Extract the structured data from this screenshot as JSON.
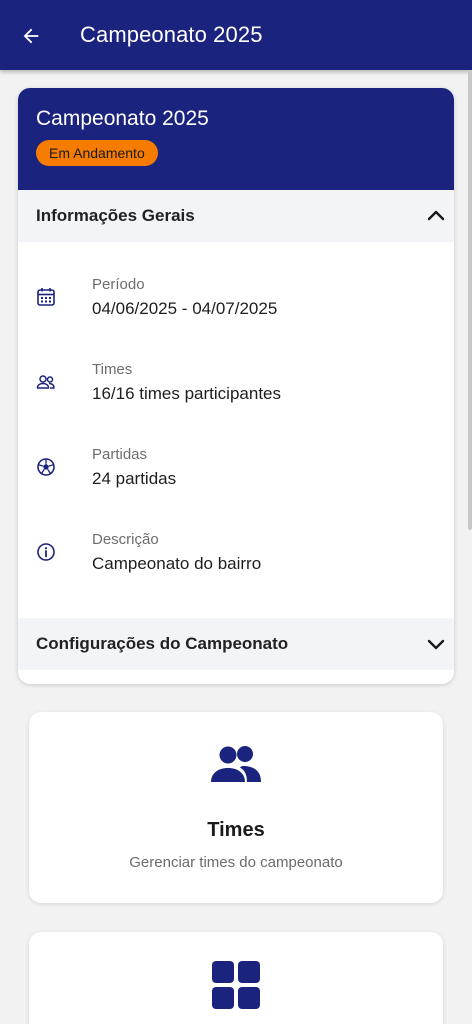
{
  "appbar": {
    "title": "Campeonato 2025",
    "back_icon": "arrow-left-icon"
  },
  "championship": {
    "title": "Campeonato 2025",
    "status": "Em Andamento",
    "colors": {
      "header": "#1a237e",
      "status_badge": "#f57c00"
    }
  },
  "general_info": {
    "title": "Informações Gerais",
    "expanded": true,
    "items": [
      {
        "icon": "calendar-icon",
        "label": "Período",
        "value": "04/06/2025 - 04/07/2025"
      },
      {
        "icon": "users-icon",
        "label": "Times",
        "value": "16/16 times participantes"
      },
      {
        "icon": "soccer-ball-icon",
        "label": "Partidas",
        "value": "24 partidas"
      },
      {
        "icon": "info-icon",
        "label": "Descrição",
        "value": "Campeonato do bairro"
      }
    ]
  },
  "settings_section": {
    "title": "Configurações do Campeonato",
    "expanded": false
  },
  "features": [
    {
      "icon": "users-icon",
      "title": "Times",
      "description": "Gerenciar times do campeonato"
    },
    {
      "icon": "grid-icon"
    }
  ]
}
